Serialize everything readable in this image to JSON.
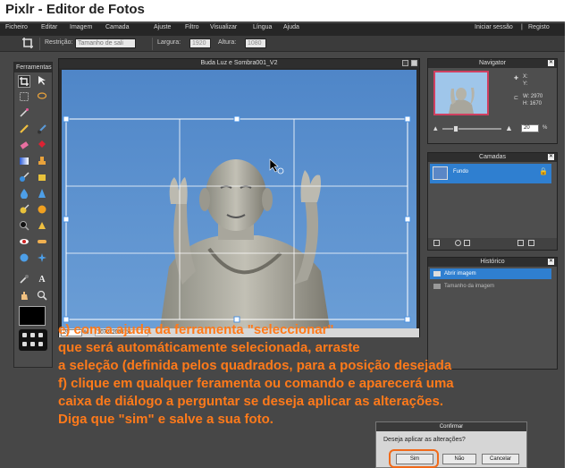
{
  "page": {
    "title": "Pixlr - Editor de Fotos"
  },
  "menubar": {
    "items": [
      "Ficheiro",
      "Editar",
      "Imagem",
      "Camada",
      "Ajuste",
      "Filtro",
      "Visualizar",
      "Língua",
      "Ajuda"
    ],
    "login": "Iniciar sessão",
    "separator": "|",
    "register": "Registo"
  },
  "toolbar": {
    "restriction_label": "Restrição:",
    "restriction_value": "Tamanho de sali",
    "width_label": "Largura:",
    "width_value": "1920",
    "height_label": "Altura:",
    "height_value": "1080"
  },
  "tools_panel": {
    "title": "Ferramentas"
  },
  "image_window": {
    "title": "Buda Luz e Sombra001_V2",
    "zoom": "20",
    "zoom_unit": "%",
    "dimensions": "3072x2048 px"
  },
  "navigator": {
    "title": "Navigator",
    "x_label": "X:",
    "y_label": "Y:",
    "w_text": "W: 2970",
    "h_text": "H: 1670",
    "zoom": "20",
    "zoom_unit": "%"
  },
  "layers": {
    "title": "Camadas",
    "items": [
      {
        "name": "Fundo"
      }
    ]
  },
  "history": {
    "title": "Histórico",
    "items": [
      {
        "label": "Abrir imagem",
        "active": true
      },
      {
        "label": "Tamanho da imagem",
        "active": false
      }
    ]
  },
  "instructions": {
    "lines": [
      "e) com a ajuda da ferramenta \"seleccionar\"",
      "que será automáticamente selecionada, arraste",
      "a seleção (definida pelos quadrados, para a posição desejada",
      "f) clique em qualquer feramenta ou comando e aparecerá uma",
      "caixa de diálogo a perguntar se deseja aplicar as alterações.",
      "Diga que \"sim\" e salve a sua foto."
    ]
  },
  "dialog": {
    "title": "Confirmar",
    "message": "Deseja aplicar as alterações?",
    "yes": "Sim",
    "no": "Não",
    "cancel": "Cancelar"
  },
  "colors": {
    "accent_orange": "#ff7a1a",
    "sky_blue": "#5c8fcd",
    "layer_selected": "#2f7fd0",
    "app_bg": "#474747"
  }
}
